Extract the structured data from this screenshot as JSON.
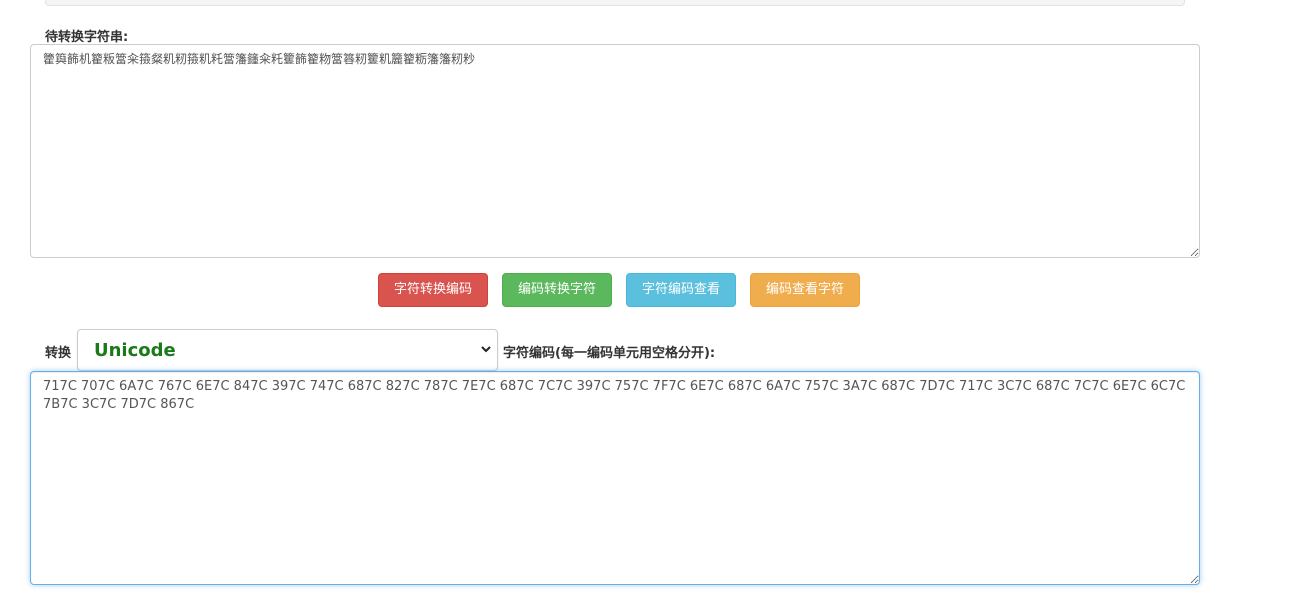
{
  "source": {
    "label": "待转换字符串:",
    "value": "籗籅籂机籊粄簹籴籡粲籶籾籡籶籷簹籓籦籴籷籰籂籊粅簹簭籾籰籶籭籊粝籓籓籾粆"
  },
  "buttons": {
    "char_to_code": "字符转换编码",
    "code_to_char": "编码转换字符",
    "view_char_code": "字符编码查看",
    "view_code_char": "编码查看字符"
  },
  "convert": {
    "label": "转换",
    "selected": "Unicode",
    "result_label": "字符编码(每一编码单元用空格分开):"
  },
  "result": {
    "value": "717C 707C 6A7C 767C 6E7C 847C 397C 747C 687C 827C 787C 7E7C 687C 7C7C 397C 757C 7F7C 6E7C 687C 6A7C 757C 3A7C 687C 7D7C 717C 3C7C 687C 7C7C 6E7C 6C7C 7B7C 3C7C 7D7C 867C"
  },
  "icons": {
    "select_arrow": "chevron-down-icon"
  }
}
